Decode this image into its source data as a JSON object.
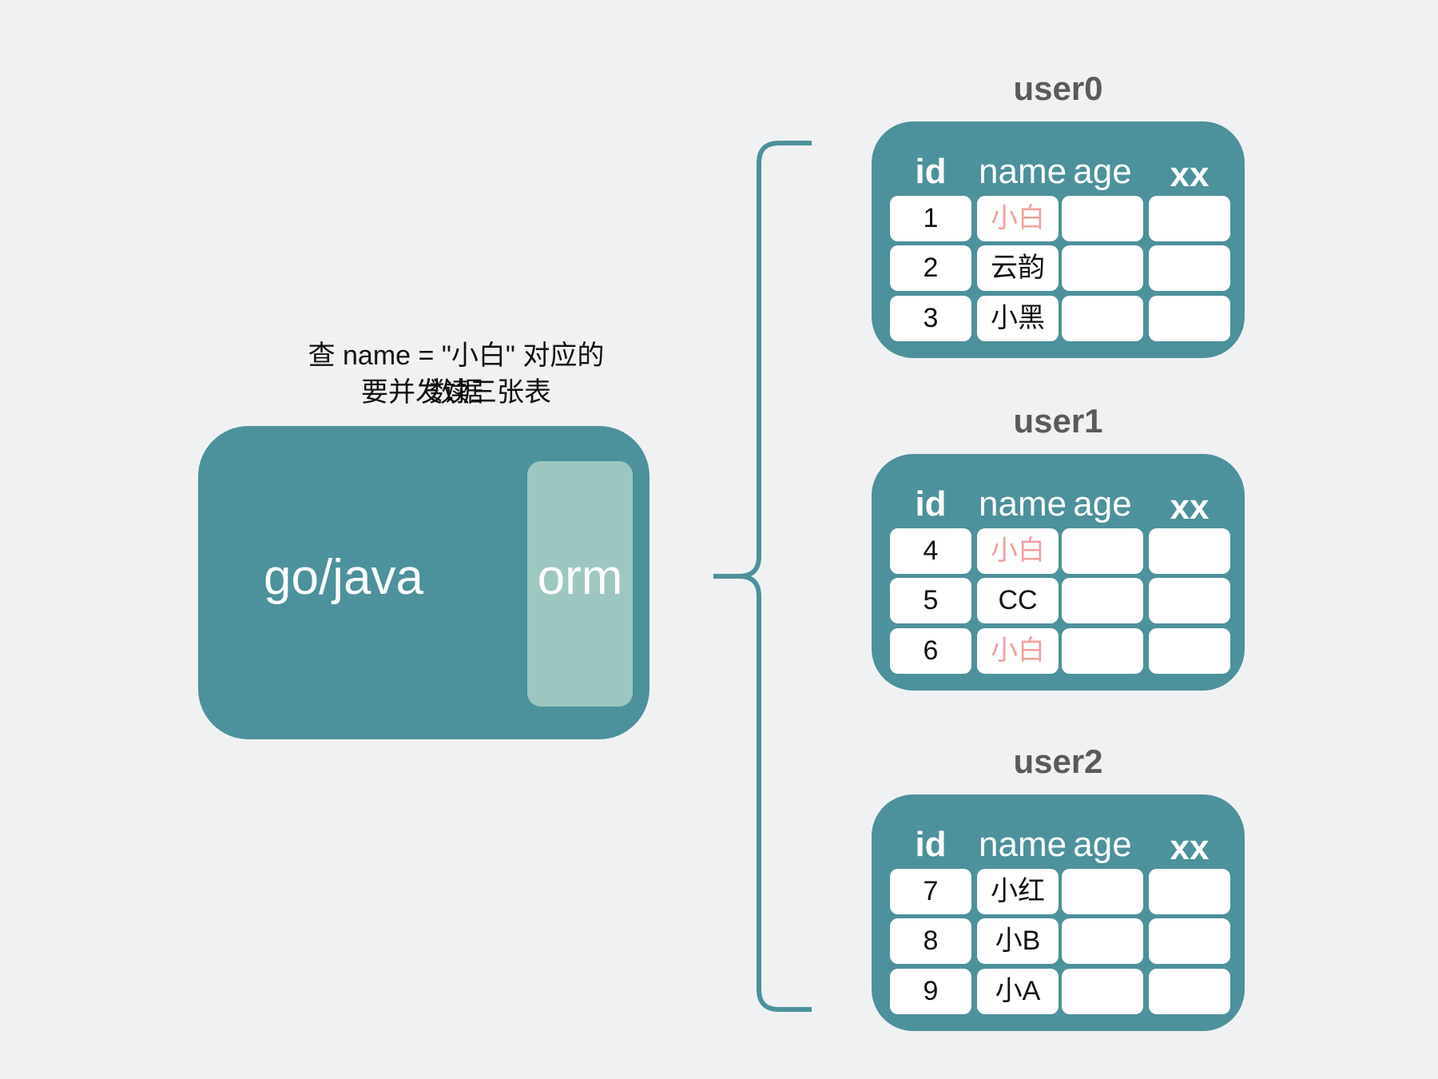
{
  "caption": {
    "line1": "查 name = \"小白\" 对应的数据",
    "line2": "要并发读三张表"
  },
  "app": {
    "label": "go/java",
    "orm_label": "orm"
  },
  "colors": {
    "teal": "#4c919b",
    "orm": "#9cc7c0",
    "highlight": "#f0a09c",
    "background": "#f0f1f3"
  },
  "columns": [
    "id",
    "name",
    "age",
    "xx"
  ],
  "tables": [
    {
      "title": "user0",
      "rows": [
        {
          "id": "1",
          "name": "小白",
          "age": "",
          "xx": "",
          "highlight": true
        },
        {
          "id": "2",
          "name": "云韵",
          "age": "",
          "xx": "",
          "highlight": false
        },
        {
          "id": "3",
          "name": "小黑",
          "age": "",
          "xx": "",
          "highlight": false
        }
      ]
    },
    {
      "title": "user1",
      "rows": [
        {
          "id": "4",
          "name": "小白",
          "age": "",
          "xx": "",
          "highlight": true
        },
        {
          "id": "5",
          "name": "CC",
          "age": "",
          "xx": "",
          "highlight": false
        },
        {
          "id": "6",
          "name": "小白",
          "age": "",
          "xx": "",
          "highlight": true
        }
      ]
    },
    {
      "title": "user2",
      "rows": [
        {
          "id": "7",
          "name": "小红",
          "age": "",
          "xx": "",
          "highlight": false
        },
        {
          "id": "8",
          "name": "小B",
          "age": "",
          "xx": "",
          "highlight": false
        },
        {
          "id": "9",
          "name": "小A",
          "age": "",
          "xx": "",
          "highlight": false
        }
      ]
    }
  ]
}
